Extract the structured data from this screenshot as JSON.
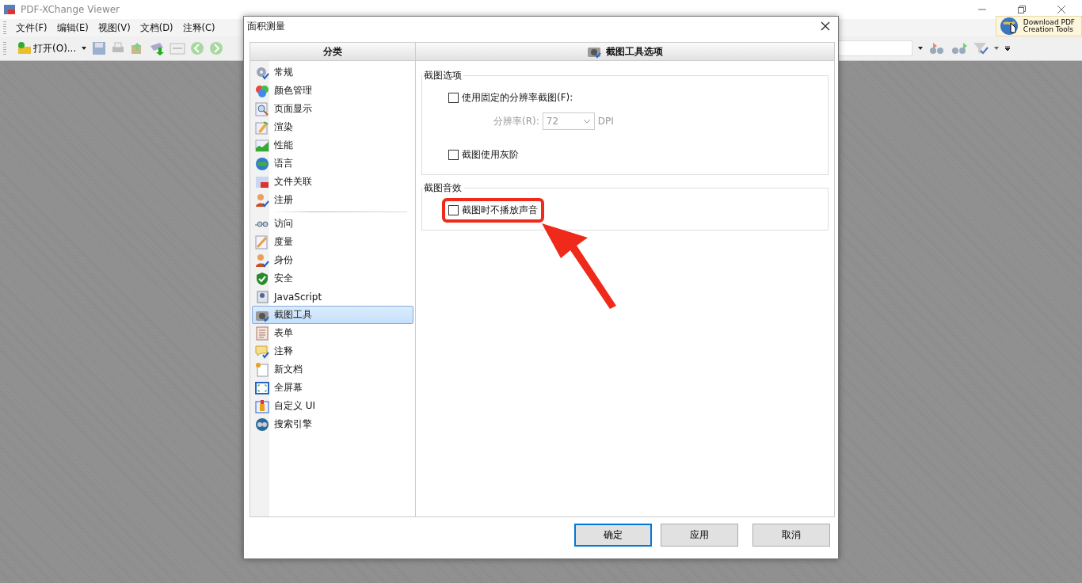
{
  "window": {
    "title": "PDF-XChange Viewer",
    "download_button": {
      "line1": "Download PDF",
      "line2": "Creation Tools"
    }
  },
  "menu": [
    "文件(F)",
    "编辑(E)",
    "视图(V)",
    "文档(D)",
    "注释(C)"
  ],
  "toolbar": {
    "open_button": "打开(O)..."
  },
  "dialog": {
    "title": "面积测量",
    "sidebar": {
      "header": "分类",
      "groups": [
        [
          {
            "label": "常规",
            "selected": false
          },
          {
            "label": "颜色管理",
            "selected": false
          },
          {
            "label": "页面显示",
            "selected": false
          },
          {
            "label": "渲染",
            "selected": false
          },
          {
            "label": "性能",
            "selected": false
          },
          {
            "label": "语言",
            "selected": false
          },
          {
            "label": "文件关联",
            "selected": false
          },
          {
            "label": "注册",
            "selected": false
          }
        ],
        [
          {
            "label": "访问",
            "selected": false
          },
          {
            "label": "度量",
            "selected": false
          },
          {
            "label": "身份",
            "selected": false
          },
          {
            "label": "安全",
            "selected": false
          },
          {
            "label": "JavaScript",
            "selected": false
          },
          {
            "label": "截图工具",
            "selected": true
          },
          {
            "label": "表单",
            "selected": false
          },
          {
            "label": "注释",
            "selected": false
          },
          {
            "label": "新文档",
            "selected": false
          },
          {
            "label": "全屏幕",
            "selected": false
          },
          {
            "label": "自定义 UI",
            "selected": false
          },
          {
            "label": "搜索引擎",
            "selected": false
          }
        ]
      ]
    },
    "panel": {
      "header": "截图工具选项",
      "groups": [
        {
          "legend": "截图选项",
          "rows": [
            {
              "kind": "checkbox",
              "label": "使用固定的分辨率截图(F):",
              "checked": false,
              "highlighted": false
            },
            {
              "kind": "combo",
              "label": "分辨率(R):",
              "value": "72",
              "unit": "DPI",
              "disabled": true
            },
            {
              "kind": "checkbox",
              "label": "截图使用灰阶",
              "checked": false,
              "highlighted": false
            }
          ]
        },
        {
          "legend": "截图音效",
          "rows": [
            {
              "kind": "checkbox",
              "label": "截图时不播放声音",
              "checked": false,
              "highlighted": true
            }
          ]
        }
      ]
    },
    "buttons": [
      {
        "label": "确定",
        "default": true
      },
      {
        "label": "应用",
        "default": false
      },
      {
        "label": "取消",
        "default": false
      }
    ]
  }
}
